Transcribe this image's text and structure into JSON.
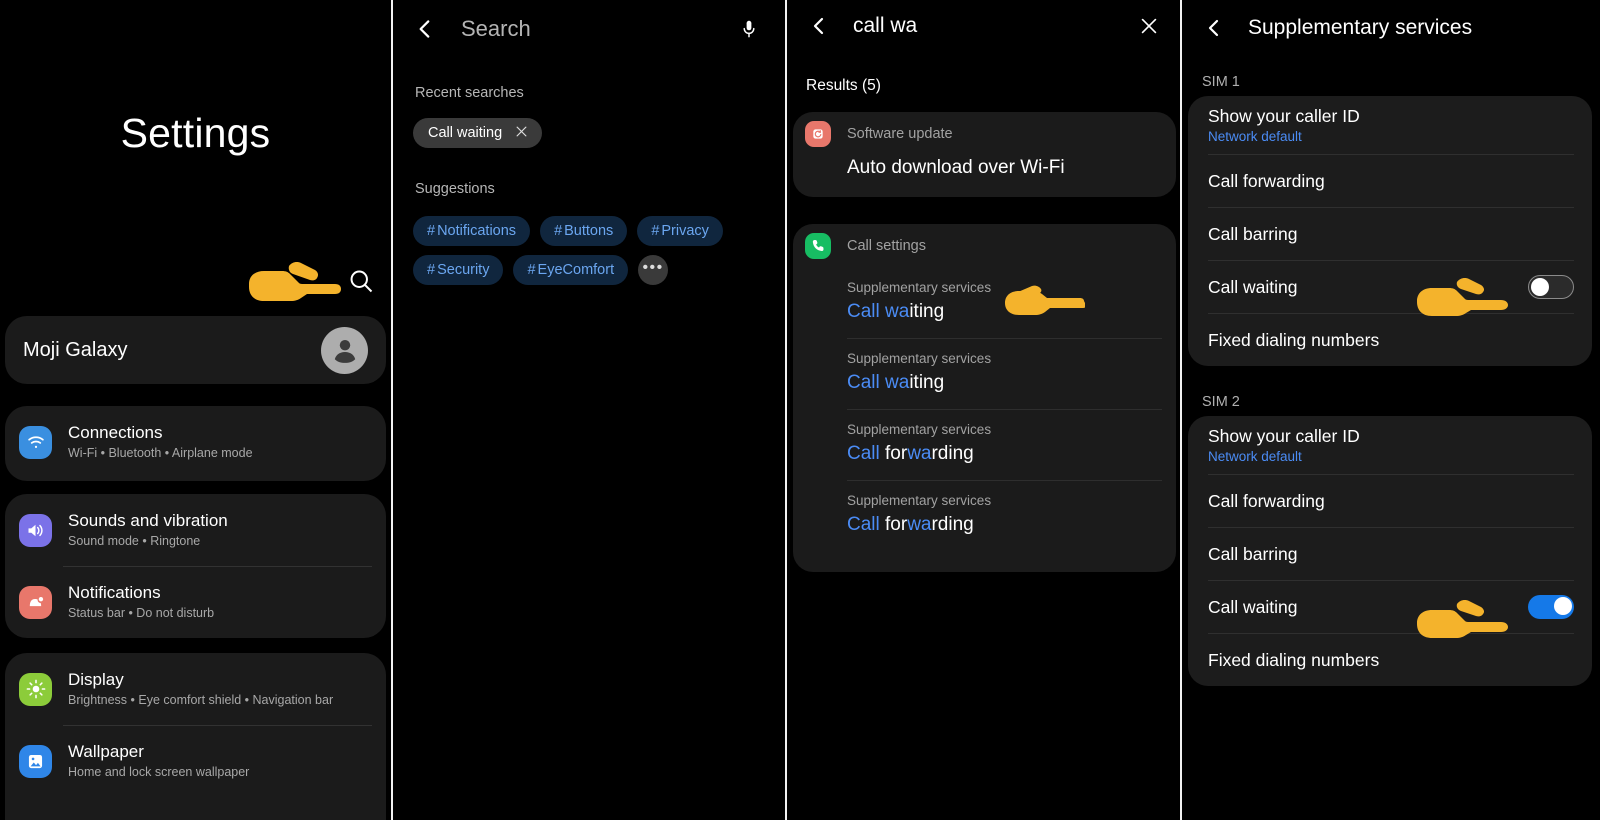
{
  "colors": {
    "accent_blue": "#4b8cf5",
    "toggle_on": "#1579e8",
    "card_bg": "#1b1b1b",
    "page_bg": "#000000",
    "chip_tag_bg": "#10263e",
    "chip_tag_text": "#6ba6f0"
  },
  "panel1": {
    "title": "Settings",
    "search_icon": "search-icon",
    "profile": {
      "name": "Moji Galaxy",
      "avatar_icon": "person-icon"
    },
    "groups": [
      {
        "items": [
          {
            "title": "Connections",
            "subtitle": "Wi-Fi  •  Bluetooth  •  Airplane mode",
            "icon": "wifi-icon",
            "icon_color": "#3a8fe0"
          }
        ]
      },
      {
        "items": [
          {
            "title": "Sounds and vibration",
            "subtitle": "Sound mode  •  Ringtone",
            "icon": "speaker-icon",
            "icon_color": "#7b72e8"
          },
          {
            "title": "Notifications",
            "subtitle": "Status bar  •  Do not disturb",
            "icon": "bell-icon",
            "icon_color": "#e8776b"
          }
        ]
      },
      {
        "items": [
          {
            "title": "Display",
            "subtitle": "Brightness  •  Eye comfort shield  •  Navigation bar",
            "icon": "brightness-icon",
            "icon_color": "#8ccc3a"
          },
          {
            "title": "Wallpaper",
            "subtitle": "Home and lock screen wallpaper",
            "icon": "image-icon",
            "icon_color": "#2f86e8"
          }
        ]
      }
    ]
  },
  "panel2": {
    "back_icon": "chevron-left-icon",
    "search_placeholder": "Search",
    "search_value": "",
    "mic_icon": "microphone-icon",
    "recent_label": "Recent searches",
    "recent_items": [
      {
        "label": "Call waiting",
        "remove_icon": "close-icon"
      }
    ],
    "suggestions_label": "Suggestions",
    "suggestions": [
      "Notifications",
      "Buttons",
      "Privacy",
      "Security",
      "EyeComfort"
    ],
    "more_label": "•••"
  },
  "panel3": {
    "back_icon": "chevron-left-icon",
    "query": "call wa",
    "clear_icon": "close-icon",
    "results_label": "Results (5)",
    "cards": [
      {
        "app": "Software update",
        "app_icon": "software-update-icon",
        "app_icon_color": "#e8776b",
        "main_result": "Auto download over Wi-Fi"
      },
      {
        "app": "Call settings",
        "app_icon": "phone-icon",
        "app_icon_color": "#17bd63",
        "items": [
          {
            "sub": "Supplementary services",
            "pre": "Call wa",
            "post": "iting"
          },
          {
            "sub": "Supplementary services",
            "pre": "Call wa",
            "post": "iting"
          },
          {
            "sub": "Supplementary services",
            "pre": "Call",
            "mid": " for",
            "hl2": "wa",
            "post": "rding"
          },
          {
            "sub": "Supplementary services",
            "pre": "Call",
            "mid": " for",
            "hl2": "wa",
            "post": "rding"
          }
        ]
      }
    ]
  },
  "panel4": {
    "back_icon": "chevron-left-icon",
    "title": "Supplementary services",
    "sections": [
      {
        "label": "SIM 1",
        "rows": [
          {
            "title": "Show your caller ID",
            "sub": "Network default",
            "toggle": null
          },
          {
            "title": "Call forwarding",
            "sub": null,
            "toggle": null
          },
          {
            "title": "Call barring",
            "sub": null,
            "toggle": null
          },
          {
            "title": "Call waiting",
            "sub": null,
            "toggle": "off"
          },
          {
            "title": "Fixed dialing numbers",
            "sub": null,
            "toggle": null
          }
        ]
      },
      {
        "label": "SIM 2",
        "rows": [
          {
            "title": "Show your caller ID",
            "sub": "Network default",
            "toggle": null
          },
          {
            "title": "Call forwarding",
            "sub": null,
            "toggle": null
          },
          {
            "title": "Call barring",
            "sub": null,
            "toggle": null
          },
          {
            "title": "Call waiting",
            "sub": null,
            "toggle": "on"
          },
          {
            "title": "Fixed dialing numbers",
            "sub": null,
            "toggle": null
          }
        ]
      }
    ]
  },
  "annotations": {
    "pointer_icon": "pointing-hand-icon",
    "count": 4
  }
}
